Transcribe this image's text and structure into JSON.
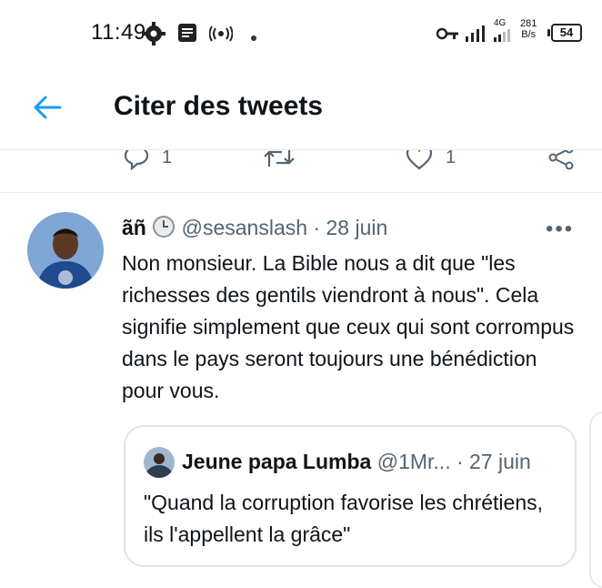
{
  "status": {
    "time": "11:49",
    "network": "4G",
    "speed_top": "281",
    "speed_bottom": "B/s",
    "battery": "54"
  },
  "header": {
    "title": "Citer des tweets"
  },
  "actions": {
    "reply_count": "1",
    "like_count": "1"
  },
  "tweet": {
    "name": "ãñ",
    "handle": "@sesanslash",
    "separator": "·",
    "date": "28 juin",
    "more": "•••",
    "text": "Non monsieur. La Bible nous a dit que \"les richesses des gentils viendront à nous\". Cela signifie simplement que ceux qui sont corrompus dans le pays seront toujours une bénédiction pour vous."
  },
  "quote": {
    "name": "Jeune papa Lumba",
    "handle": "@1Mr...",
    "separator": "·",
    "date": "27 juin",
    "text": "\"Quand la corruption favorise les chrétiens, ils l'appellent la grâce\""
  },
  "colors": {
    "accent": "#1d9bf0",
    "muted": "#536471",
    "border": "#e6ecf0"
  }
}
